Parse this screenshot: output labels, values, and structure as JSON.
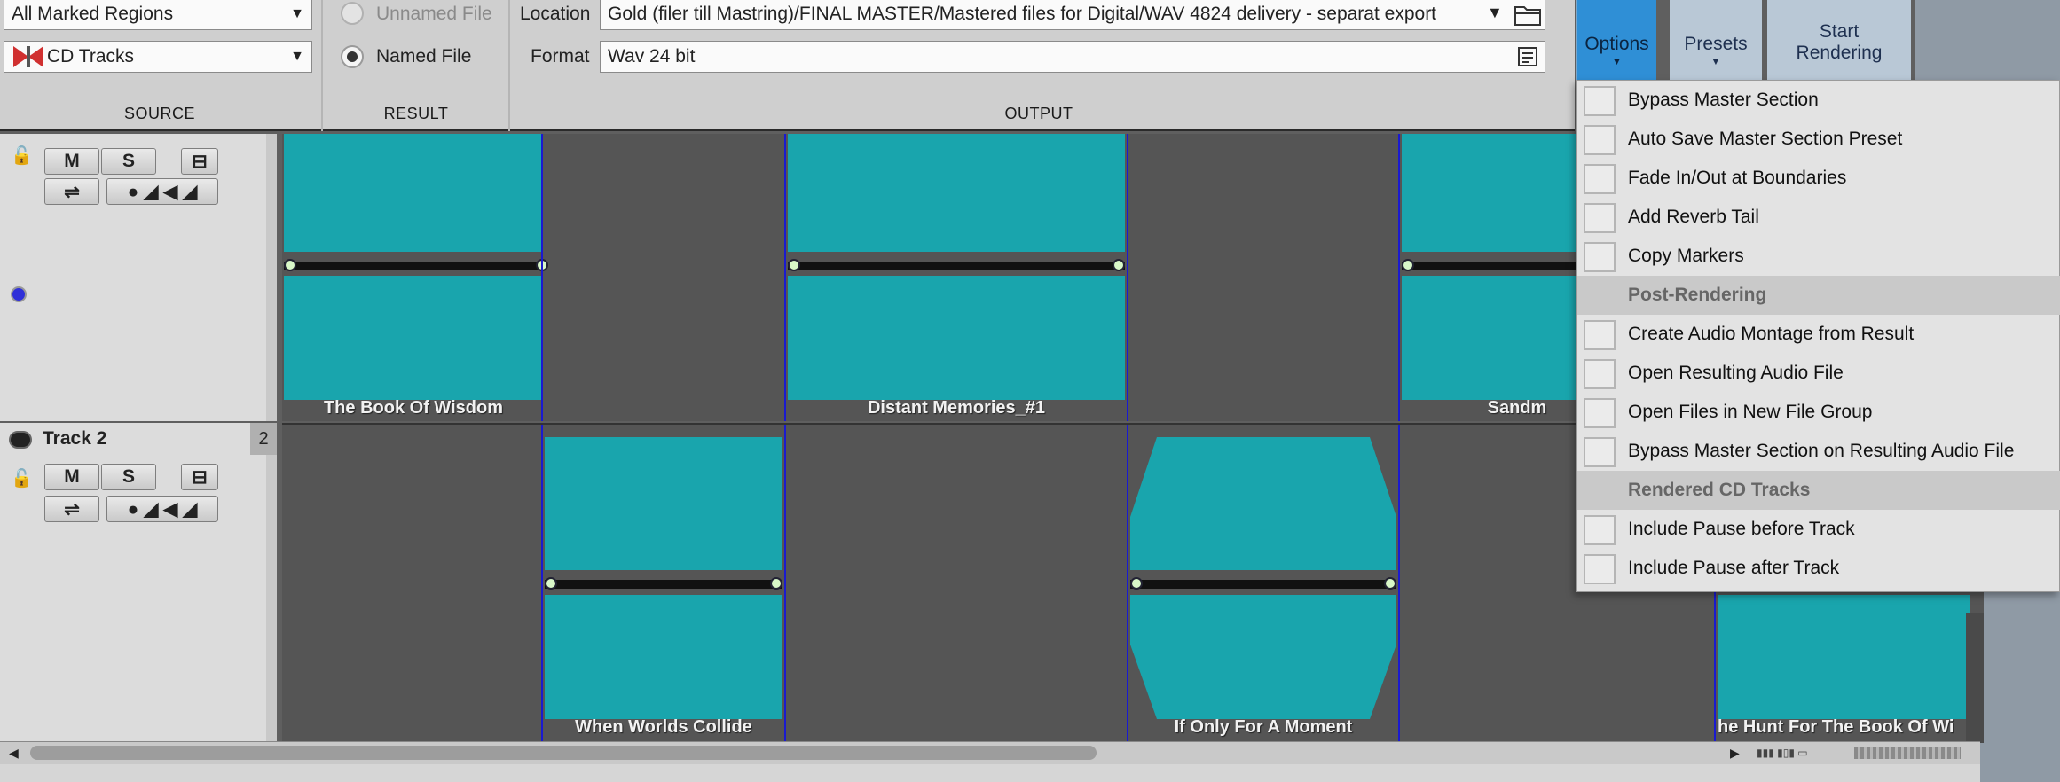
{
  "source": {
    "range_dropdown": "All Marked Regions",
    "type_dropdown": "CD Tracks",
    "section_label": "SOURCE"
  },
  "result": {
    "unnamed_label": "Unnamed File",
    "named_label": "Named File",
    "selected": "Named File",
    "section_label": "RESULT"
  },
  "output": {
    "location_label": "Location",
    "location_value": "Gold (filer till Mastring)/FINAL MASTER/Mastered files for Digital/WAV 4824 delivery - separat export",
    "format_label": "Format",
    "format_value": "Wav 24 bit",
    "section_label": "OUTPUT"
  },
  "buttons": {
    "options": "Options",
    "presets": "Presets",
    "start_rendering_line1": "Start",
    "start_rendering_line2": "Rendering"
  },
  "tracks": [
    {
      "name": "",
      "number": "",
      "mute": "M",
      "solo": "S"
    },
    {
      "name": "Track 2",
      "number": "2",
      "mute": "M",
      "solo": "S"
    }
  ],
  "clips": {
    "track1": [
      "The Book Of Wisdom",
      "Distant Memories_#1",
      "Sandm"
    ],
    "track2": [
      "When Worlds Collide",
      "If Only For A Moment",
      "he Hunt For The Book Of Wi"
    ]
  },
  "options_menu": {
    "items_group1": [
      "Bypass Master Section",
      "Auto Save Master Section Preset",
      "Fade In/Out at Boundaries",
      "Add Reverb Tail",
      "Copy Markers"
    ],
    "header_post": "Post-Rendering",
    "items_group2": [
      "Create Audio Montage from Result",
      "Open Resulting Audio File",
      "Open Files in New File Group",
      "Bypass Master Section on Resulting Audio File"
    ],
    "header_cd": "Rendered CD Tracks",
    "items_group3": [
      "Include Pause before Track",
      "Include Pause after Track"
    ]
  },
  "colors": {
    "waveform": "#19a5ad",
    "options_active": "#2f8fd6",
    "lane_bg": "#555555",
    "clip_boundary": "#1a1ad0"
  },
  "icons": [
    "folder-icon",
    "notes-icon",
    "lock-icon",
    "record-icon",
    "speaker-icon",
    "routing-icon",
    "cd-icon"
  ]
}
